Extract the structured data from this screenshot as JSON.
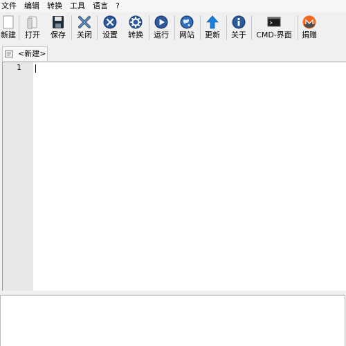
{
  "menubar": {
    "items": [
      "文件",
      "编辑",
      "转换",
      "工具",
      "语言",
      "?"
    ]
  },
  "toolbar": {
    "buttons": [
      {
        "label": "新建",
        "icon": "new-file-icon"
      },
      {
        "label": "打开",
        "icon": "open-file-icon"
      },
      {
        "label": "保存",
        "icon": "floppy-disk-icon"
      },
      {
        "label": "关闭",
        "icon": "close-x-icon"
      },
      {
        "label": "设置",
        "icon": "settings-wrench-icon"
      },
      {
        "label": "转换",
        "icon": "gear-icon"
      },
      {
        "label": "运行",
        "icon": "play-icon"
      },
      {
        "label": "网站",
        "icon": "globe-icon"
      },
      {
        "label": "更新",
        "icon": "up-arrow-icon"
      },
      {
        "label": "关于",
        "icon": "info-icon"
      },
      {
        "label": "CMD-界面",
        "icon": "terminal-icon"
      },
      {
        "label": "捐赠",
        "icon": "monero-icon"
      }
    ]
  },
  "tabs": [
    {
      "label": "<新建>",
      "icon": "document-tab-icon"
    }
  ],
  "editor": {
    "line_numbers": [
      "1"
    ]
  },
  "colors": {
    "accent_blue": "#1e5fbf",
    "monero_orange": "#f26822",
    "arrow_blue": "#1a7fd8"
  }
}
